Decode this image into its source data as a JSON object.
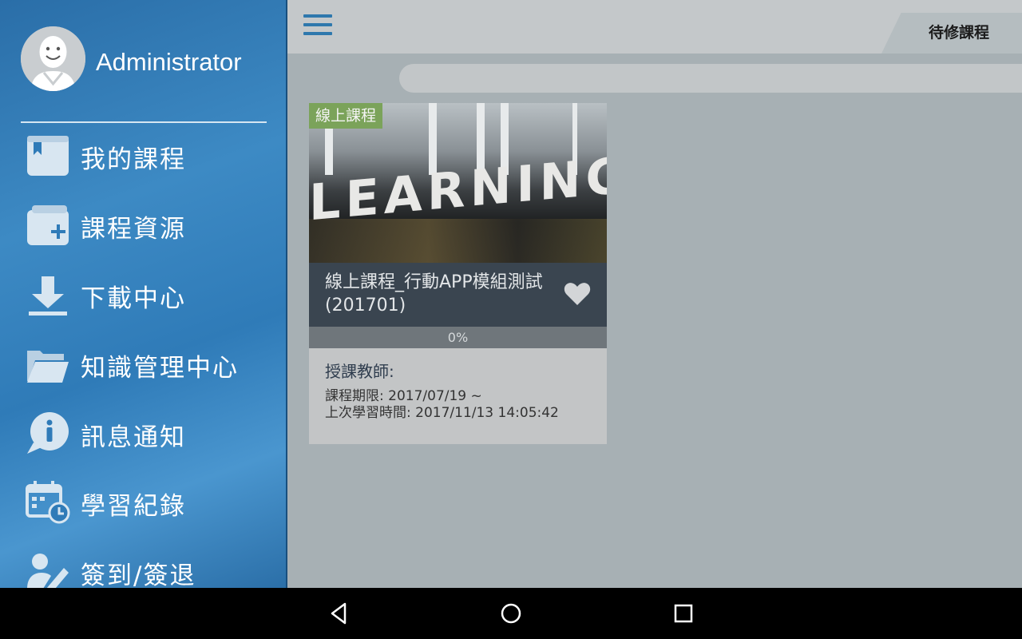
{
  "sidebar": {
    "user_name": "Administrator",
    "items": [
      {
        "label": "我的課程",
        "icon": "bookmark-book-icon"
      },
      {
        "label": "課程資源",
        "icon": "folder-add-icon"
      },
      {
        "label": "下載中心",
        "icon": "download-icon"
      },
      {
        "label": "知識管理中心",
        "icon": "open-folder-icon"
      },
      {
        "label": "訊息通知",
        "icon": "info-bubble-icon"
      },
      {
        "label": "學習紀錄",
        "icon": "calendar-clock-icon"
      },
      {
        "label": "簽到/簽退",
        "icon": "user-edit-icon"
      }
    ]
  },
  "header": {
    "tab_label": "待修課程"
  },
  "course": {
    "badge": "線上課程",
    "image_text": "LEARNING",
    "title": "線上課程_行動APP模組測試(201701)",
    "progress_text": "0%",
    "progress": 0,
    "teacher_label": "授課教師:",
    "period_label": "課程期限: 2017/07/19 ~",
    "last_study": "上次學習時間: 2017/11/13 14:05:42"
  },
  "colors": {
    "accent": "#2e78ad",
    "badge": "#7ba35a",
    "title_strip": "#3a4550"
  }
}
